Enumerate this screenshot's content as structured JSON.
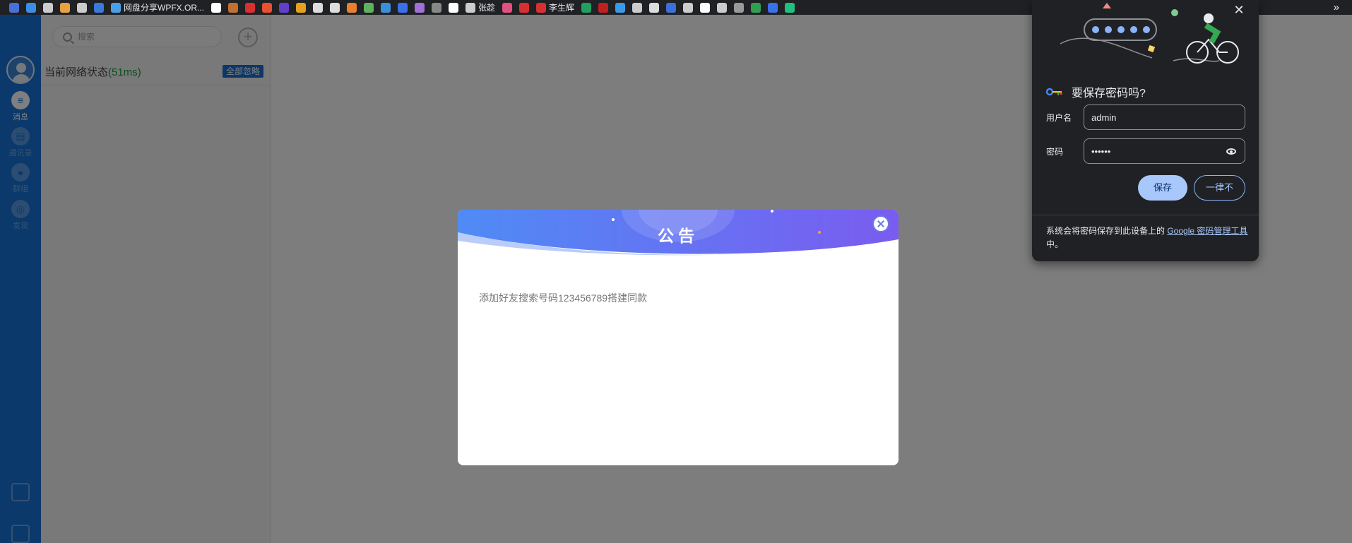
{
  "bookmarks": {
    "items": [
      {
        "label": "",
        "color": "#4a6fd8"
      },
      {
        "label": "",
        "color": "#3a8ee8"
      },
      {
        "label": "",
        "color": "#cccccc"
      },
      {
        "label": "",
        "color": "#e8a040"
      },
      {
        "label": "",
        "color": "#cccccc"
      },
      {
        "label": "",
        "color": "#3a7ad8"
      },
      {
        "label": "网盘分享WPFX.OR...",
        "color": "#4aa0e8"
      },
      {
        "label": "",
        "color": "#ffffff"
      },
      {
        "label": "",
        "color": "#c07030"
      },
      {
        "label": "",
        "color": "#d83030"
      },
      {
        "label": "",
        "color": "#e85030"
      },
      {
        "label": "",
        "color": "#6040c8"
      },
      {
        "label": "",
        "color": "#e8a020"
      },
      {
        "label": "",
        "color": "#dddddd"
      },
      {
        "label": "",
        "color": "#dddddd"
      },
      {
        "label": "",
        "color": "#e88030"
      },
      {
        "label": "",
        "color": "#60b060"
      },
      {
        "label": "",
        "color": "#3a90d8"
      },
      {
        "label": "",
        "color": "#3a70e8"
      },
      {
        "label": "",
        "color": "#a070d8"
      },
      {
        "label": "",
        "color": "#888888"
      },
      {
        "label": "",
        "color": "#ffffff"
      },
      {
        "label": "张趁",
        "color": "#cccccc"
      },
      {
        "label": "",
        "color": "#e05080"
      },
      {
        "label": "",
        "color": "#d83030"
      },
      {
        "label": "李生辉",
        "color": "#d83030"
      },
      {
        "label": "",
        "color": "#20a060"
      },
      {
        "label": "",
        "color": "#c02020"
      },
      {
        "label": "",
        "color": "#3a9ae8"
      },
      {
        "label": "",
        "color": "#cccccc"
      },
      {
        "label": "",
        "color": "#dddddd"
      },
      {
        "label": "",
        "color": "#3a70d8"
      },
      {
        "label": "",
        "color": "#cccccc"
      },
      {
        "label": "",
        "color": "#ffffff"
      },
      {
        "label": "",
        "color": "#cccccc"
      },
      {
        "label": "",
        "color": "#999999"
      },
      {
        "label": "",
        "color": "#30a050"
      },
      {
        "label": "",
        "color": "#3a70e8"
      },
      {
        "label": "",
        "color": "#20c080"
      }
    ]
  },
  "app": {
    "rail": {
      "items": [
        {
          "label": "消息",
          "glyph": "≡",
          "icon": "chat-icon",
          "active": true
        },
        {
          "label": "通讯录",
          "glyph": "▤",
          "icon": "contacts-icon",
          "active": false
        },
        {
          "label": "群组",
          "glyph": "●",
          "icon": "group-icon",
          "active": false
        },
        {
          "label": "发现",
          "glyph": "◎",
          "icon": "compass-icon",
          "active": false
        }
      ],
      "bottom_icons": [
        "calendar-icon",
        "shield-icon"
      ]
    },
    "side": {
      "search_placeholder": "搜索",
      "add_glyph": "+",
      "net_status_label": "当前网络状态",
      "net_status_ms": "(51ms)",
      "ignore_all": "全部忽略"
    }
  },
  "modal": {
    "title": "公告",
    "body": "添加好友搜索号码123456789搭建同款",
    "colors": {
      "header_start": "#4f8bf5",
      "header_end": "#7a5cf0"
    }
  },
  "password_popup": {
    "close_glyph": "✕",
    "title": "要保存密码吗?",
    "username_label": "用户名",
    "username_value": "admin",
    "password_label": "密码",
    "password_value": "••••••",
    "save_label": "保存",
    "never_label": "一律不",
    "footer_prefix": "系统会将密码保存到此设备上的 ",
    "footer_link": "Google 密码管理工具",
    "footer_suffix": "中。",
    "colors": {
      "bg": "#202124",
      "accent": "#a8c7fa"
    }
  }
}
